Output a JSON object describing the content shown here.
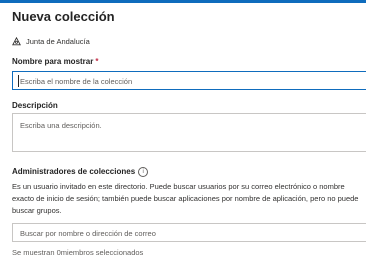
{
  "panel": {
    "title": "Nueva colección",
    "organization": "Junta de Andalucía",
    "accent_color": "#0f6cbd"
  },
  "display_name": {
    "label": "Nombre para mostrar",
    "required_marker": "*",
    "placeholder": "Escriba el nombre de la colección",
    "value": ""
  },
  "description": {
    "label": "Descripción",
    "placeholder": "Escriba una descripción.",
    "value": ""
  },
  "admins": {
    "label": "Administradores de colecciones",
    "info_icon": "info-icon",
    "help_text": "Es un usuario invitado en este directorio. Puede buscar usuarios por su correo electrónico o nombre exacto de inicio de sesión; también puede buscar aplicaciones por nombre de aplicación, pero no puede buscar grupos.",
    "search_placeholder": "Buscar por nombre o dirección de correo",
    "selected_count_text": "Se muestran 0miembros seleccionados"
  }
}
